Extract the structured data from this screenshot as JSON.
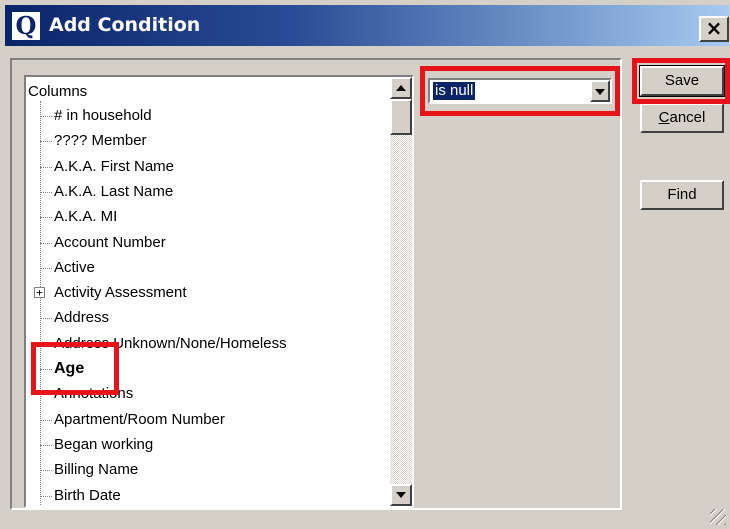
{
  "dialog": {
    "icon_glyph": "Q",
    "title": "Add Condition",
    "close_glyph": "×"
  },
  "tree": {
    "root_label": "Columns",
    "items": [
      {
        "label": "# in household",
        "expandable": false
      },
      {
        "label": "???? Member",
        "expandable": false
      },
      {
        "label": "A.K.A. First Name",
        "expandable": false
      },
      {
        "label": "A.K.A. Last Name",
        "expandable": false
      },
      {
        "label": "A.K.A. MI",
        "expandable": false
      },
      {
        "label": "Account Number",
        "expandable": false
      },
      {
        "label": "Active",
        "expandable": false
      },
      {
        "label": "Activity Assessment",
        "expandable": true
      },
      {
        "label": "Address",
        "expandable": false
      },
      {
        "label": "Address Unknown/None/Homeless",
        "expandable": false
      },
      {
        "label": "Age",
        "expandable": false,
        "selected": true
      },
      {
        "label": "Annotations",
        "expandable": false
      },
      {
        "label": "Apartment/Room Number",
        "expandable": false
      },
      {
        "label": "Began working",
        "expandable": false
      },
      {
        "label": "Billing Name",
        "expandable": false
      },
      {
        "label": "Birth Date",
        "expandable": false
      }
    ]
  },
  "operator": {
    "selected_value": "is null"
  },
  "buttons": {
    "save": "Save",
    "cancel": "Cancel",
    "find": "Find"
  },
  "highlight_color": "#e8121a",
  "title_bar_color": "#0a246a"
}
